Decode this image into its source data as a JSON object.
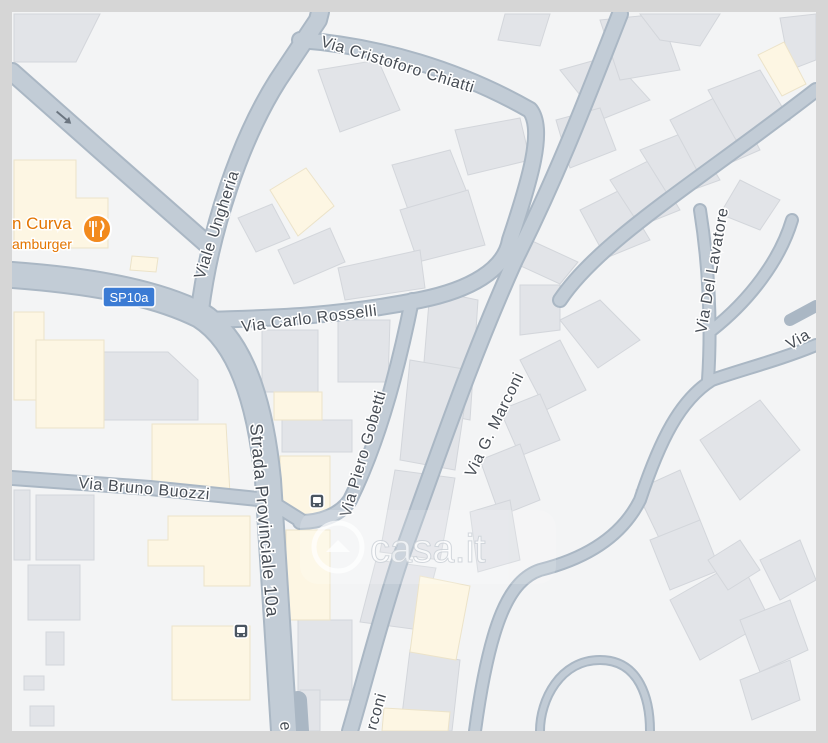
{
  "streets": {
    "cristoforo_chiatti": "Via Cristoforo Chiatti",
    "viale_ungheria": "Viale Ungheria",
    "carlo_rosselli": "Via Carlo Rosselli",
    "piero_gobetti": "Via Piero Gobetti",
    "g_marconi": "Via G. Marconi",
    "del_lavatore": "Via Del Lavatore",
    "bruno_buozzi": "Via Bruno Buozzi",
    "provinciale": "Strada Provinciale 10a",
    "marconi_bottom": "rconi",
    "right_edge": "Via"
  },
  "road_shield": "SP10a",
  "poi": {
    "name": "n Curva",
    "category": "amburger",
    "icon": "restaurant-icon"
  },
  "watermark": "casa.it",
  "colors": {
    "road_casing": "#aab7c4",
    "road_fill": "#c2ccd6",
    "building": "#e2e4e8",
    "building_highlight": "#fdf6e3",
    "poi_accent": "#f28a1d",
    "shield": "#3b7bd4"
  }
}
